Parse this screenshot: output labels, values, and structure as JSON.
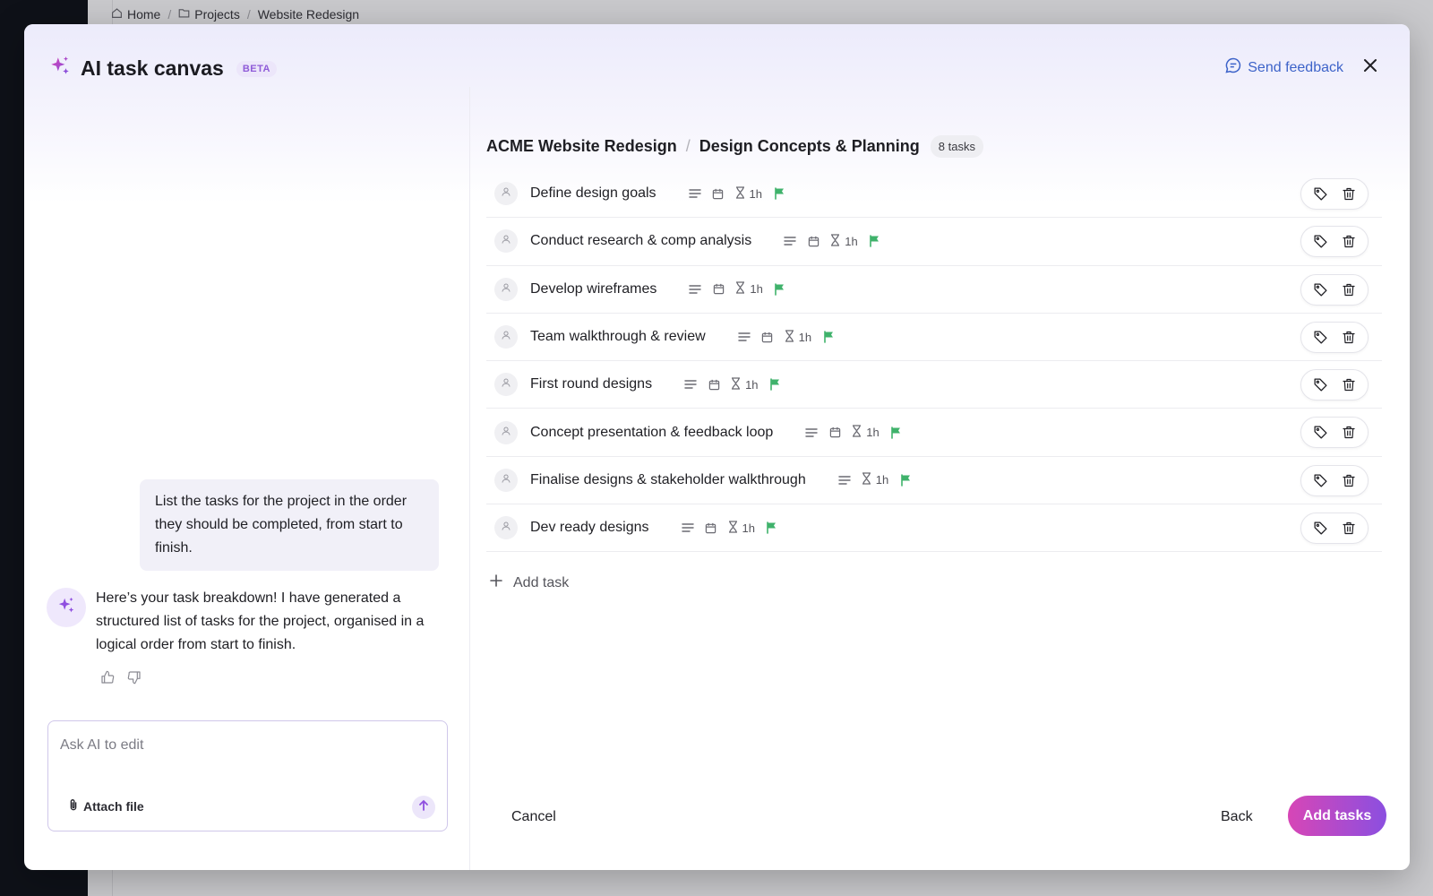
{
  "background": {
    "breadcrumb": [
      "Home",
      "Projects",
      "Website Redesign"
    ]
  },
  "modal": {
    "title": "AI task canvas",
    "badge": "BETA",
    "send_feedback": "Send feedback"
  },
  "chat": {
    "user_message": "List the tasks for the project in the order they should be completed, from start to finish.",
    "ai_message": "Here’s your task breakdown! I have generated a structured list of tasks for the project, organised in a logical order from start to finish.",
    "input_placeholder": "Ask AI to edit",
    "attach_label": "Attach file"
  },
  "tasks_panel": {
    "project": "ACME Website Redesign",
    "section": "Design Concepts & Planning",
    "count_label": "8 tasks",
    "tasks": [
      {
        "name": "Define design goals",
        "estimate": "1h",
        "has_date": true
      },
      {
        "name": "Conduct research & comp analysis",
        "estimate": "1h",
        "has_date": true
      },
      {
        "name": "Develop wireframes",
        "estimate": "1h",
        "has_date": true
      },
      {
        "name": "Team walkthrough & review",
        "estimate": "1h",
        "has_date": true
      },
      {
        "name": "First round designs",
        "estimate": "1h",
        "has_date": true
      },
      {
        "name": "Concept presentation & feedback loop",
        "estimate": "1h",
        "has_date": true
      },
      {
        "name": "Finalise designs & stakeholder walkthrough",
        "estimate": "1h",
        "has_date": false
      },
      {
        "name": "Dev ready designs",
        "estimate": "1h",
        "has_date": true
      }
    ],
    "add_task_label": "Add task"
  },
  "footer": {
    "cancel": "Cancel",
    "back": "Back",
    "add_tasks": "Add tasks"
  },
  "colors": {
    "accent_purple": "#8b4fe0",
    "accent_pink": "#d746b6",
    "flag_green": "#3fb26b",
    "link_blue": "#3d63c9"
  }
}
